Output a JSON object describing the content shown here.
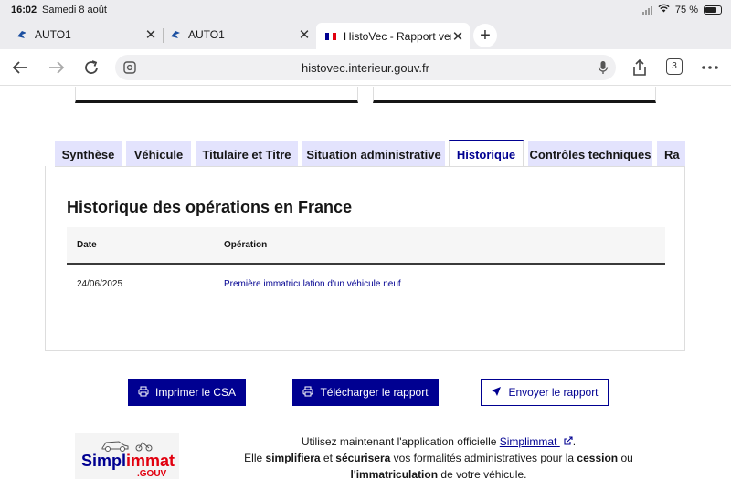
{
  "status_bar": {
    "time": "16:02",
    "date": "Samedi 8 août",
    "battery": "75 %",
    "battery_level": 0.75
  },
  "browser_tabs": [
    {
      "label": "AUTO1",
      "favicon": "auto1-logo-icon"
    },
    {
      "label": "AUTO1",
      "favicon": "auto1-logo-icon"
    },
    {
      "label": "HistoVec - Rapport vendeur",
      "favicon": "french-flag-icon"
    }
  ],
  "address_bar": {
    "url": "histovec.interieur.gouv.fr",
    "tab_count": "3"
  },
  "report_tabs": [
    {
      "label": "Synthèse"
    },
    {
      "label": "Véhicule"
    },
    {
      "label": "Titulaire et Titre"
    },
    {
      "label": "Situation administrative"
    },
    {
      "label": "Historique"
    },
    {
      "label": "Contrôles techniques"
    },
    {
      "label": "Ra"
    }
  ],
  "selected_tab": "Historique",
  "history": {
    "title": "Historique des opérations en France",
    "columns": {
      "date": "Date",
      "operation": "Opération"
    },
    "rows": [
      {
        "date": "24/06/2025",
        "operation": "Première immatriculation d'un véhicule neuf"
      }
    ]
  },
  "actions": {
    "print": "Imprimer le CSA",
    "download": "Télécharger le rapport",
    "send": "Envoyer le rapport"
  },
  "promo": {
    "line1_prefix": "Utilisez maintenant l'application officielle",
    "link": "Simplimmat",
    "line1_suffix": ".",
    "line2_a": "Elle",
    "line2_b": "simplifiera",
    "line2_c": "et",
    "line2_d": "sécurisera",
    "line2_e": "vos formalités administratives pour la",
    "line2_f": "cession",
    "line2_g": "ou",
    "line3_a": "l'immatriculation",
    "line3_b": "de votre véhicule.",
    "logo_main": "Simpl",
    "logo_accent": "immat",
    "logo_sub": ".GOUV"
  },
  "colors": {
    "primary": "#000091",
    "tab_bg": "#e3e3fd",
    "accent_red": "#e1000f"
  }
}
